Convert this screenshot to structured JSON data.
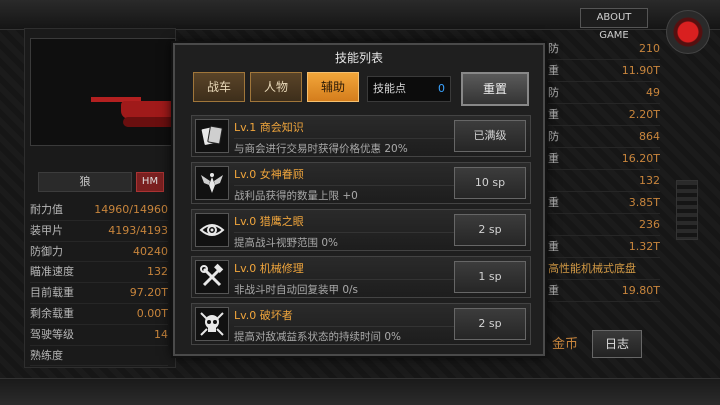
{
  "top": {
    "about_label": "ABOUT GAME"
  },
  "tank": {
    "name": "狼",
    "badge": "HM"
  },
  "stats": [
    {
      "label": "耐力值",
      "value": "14960/14960"
    },
    {
      "label": "装甲片",
      "value": "4193/4193"
    },
    {
      "label": "防御力",
      "value": "40240"
    },
    {
      "label": "瞄准速度",
      "value": "132"
    },
    {
      "label": "目前载重",
      "value": "97.20T"
    },
    {
      "label": "剩余载重",
      "value": "0.00T"
    },
    {
      "label": "驾驶等级",
      "value": "14"
    },
    {
      "label": "熟练度",
      "value": ""
    }
  ],
  "right_stats": [
    {
      "label": "防",
      "value": "210"
    },
    {
      "label": "重",
      "value": "11.90T"
    },
    {
      "label": "防",
      "value": "49"
    },
    {
      "label": "重",
      "value": "2.20T"
    },
    {
      "label": "防",
      "value": "864"
    },
    {
      "label": "重",
      "value": "16.20T"
    },
    {
      "label": "",
      "value": "132"
    },
    {
      "label": "重",
      "value": "3.85T"
    },
    {
      "label": "",
      "value": "236"
    },
    {
      "label": "重",
      "value": "1.32T"
    },
    {
      "label": "高性能机械式底盘",
      "value": ""
    },
    {
      "label": "重",
      "value": "19.80T"
    }
  ],
  "bottom": {
    "gold_label": "金币",
    "log_label": "日志"
  },
  "modal": {
    "title": "技能列表",
    "tabs": [
      "战车",
      "人物",
      "辅助"
    ],
    "active_tab": 2,
    "points_label": "技能点",
    "points_value": "0",
    "reset_label": "重置",
    "skills": [
      {
        "icon": "cards-icon",
        "name": "Lv.1 商会知识",
        "desc": "与商会进行交易时获得价格优惠 20%",
        "button": "已满级"
      },
      {
        "icon": "winged-emblem-icon",
        "name": "Lv.0 女神眷顾",
        "desc": "战利品获得的数量上限 +0",
        "button": "10 sp"
      },
      {
        "icon": "eye-icon",
        "name": "Lv.0 猎鹰之眼",
        "desc": "提高战斗视野范围 0%",
        "button": "2 sp"
      },
      {
        "icon": "wrench-hammer-icon",
        "name": "Lv.0 机械修理",
        "desc": "非战斗时自动回复装甲 0/s",
        "button": "1 sp"
      },
      {
        "icon": "skull-icon",
        "name": "Lv.0 破坏者",
        "desc": "提高对敌减益系状态的持续时间 0%",
        "button": "2 sp"
      }
    ]
  }
}
